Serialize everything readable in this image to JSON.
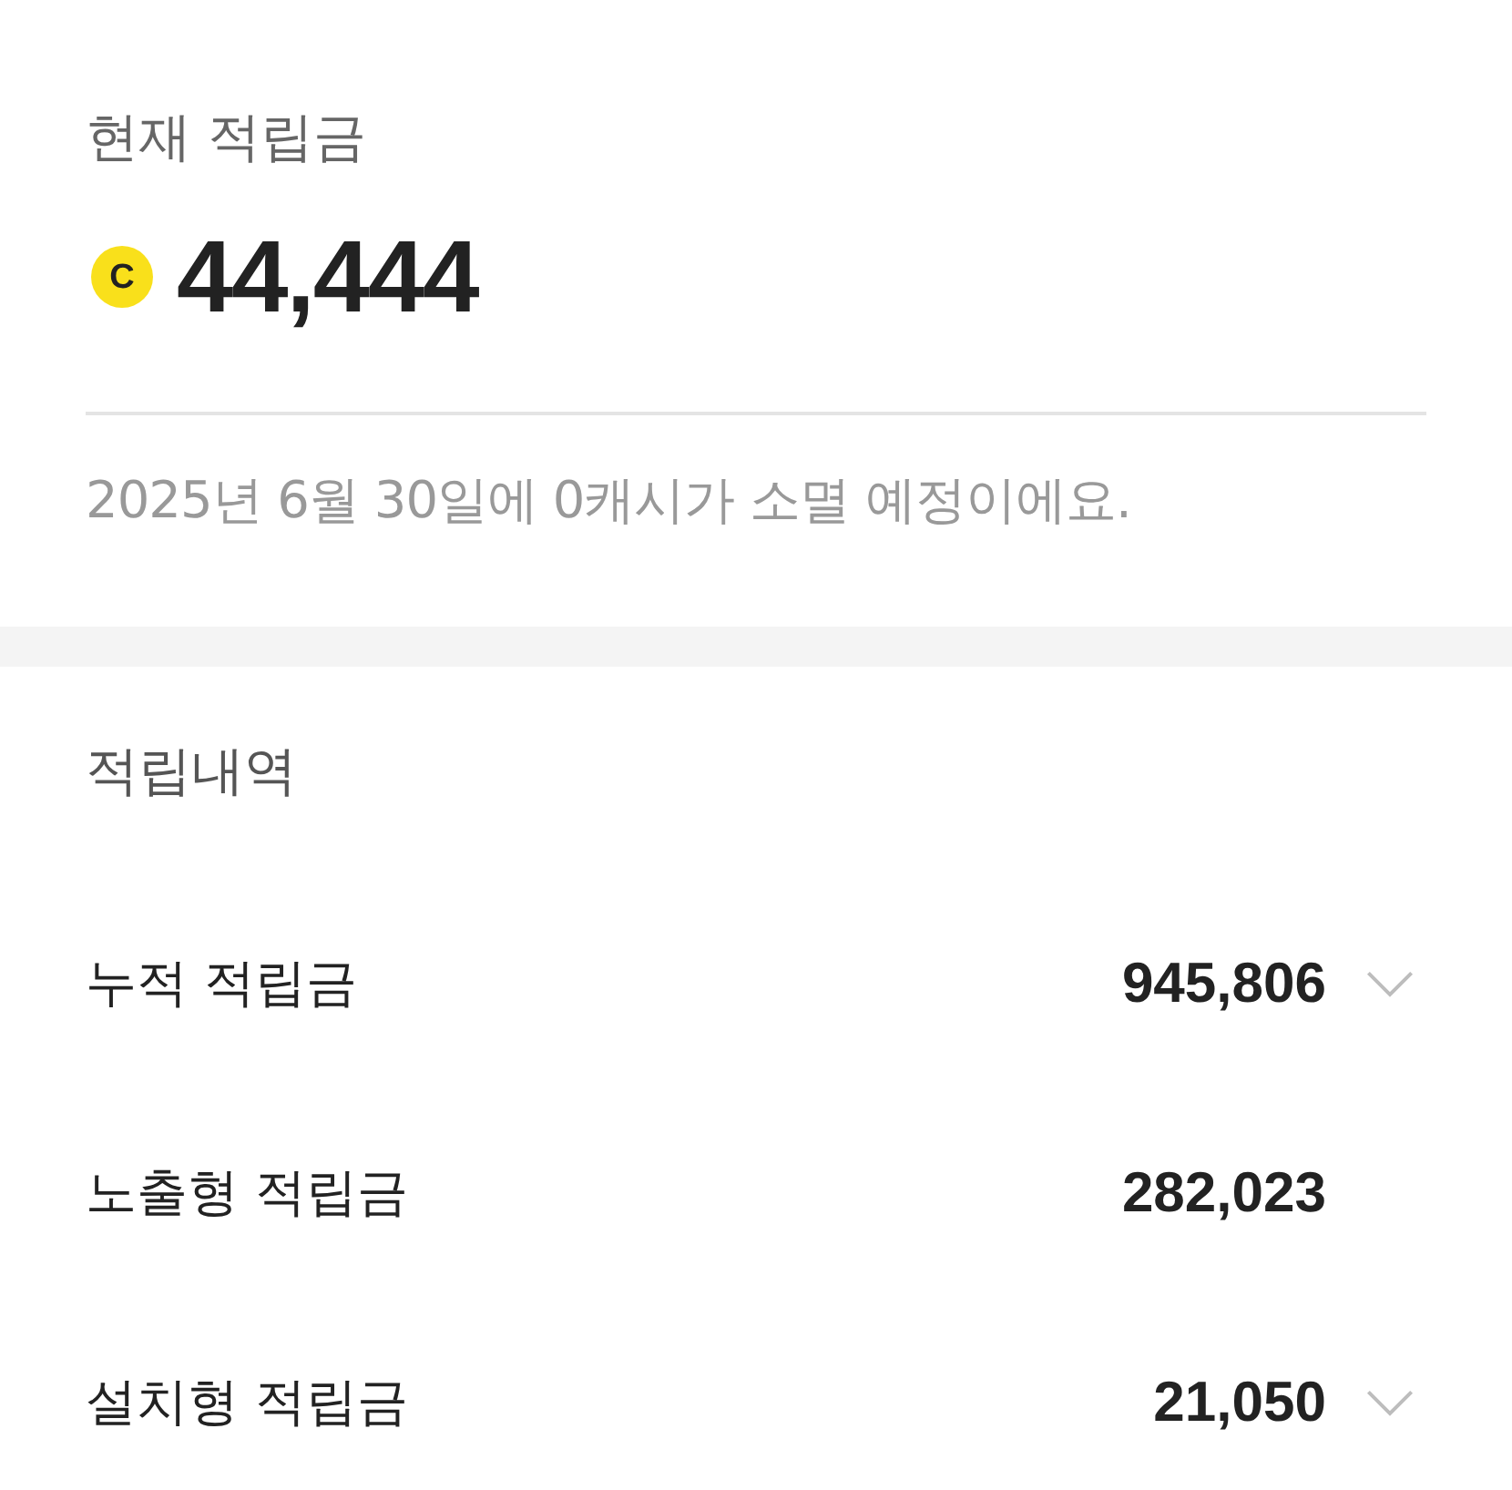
{
  "balance_section": {
    "title": "현재 적립금",
    "coin_symbol": "C",
    "amount": "44,444",
    "notice": "2025년 6월 30일에 0캐시가 소멸 예정이에요."
  },
  "history_section": {
    "title": "적립내역",
    "rows": [
      {
        "label": "누적 적립금",
        "value": "945,806",
        "expandable": true
      },
      {
        "label": "노출형 적립금",
        "value": "282,023",
        "expandable": false
      },
      {
        "label": "설치형 적립금",
        "value": "21,050",
        "expandable": true
      }
    ]
  }
}
